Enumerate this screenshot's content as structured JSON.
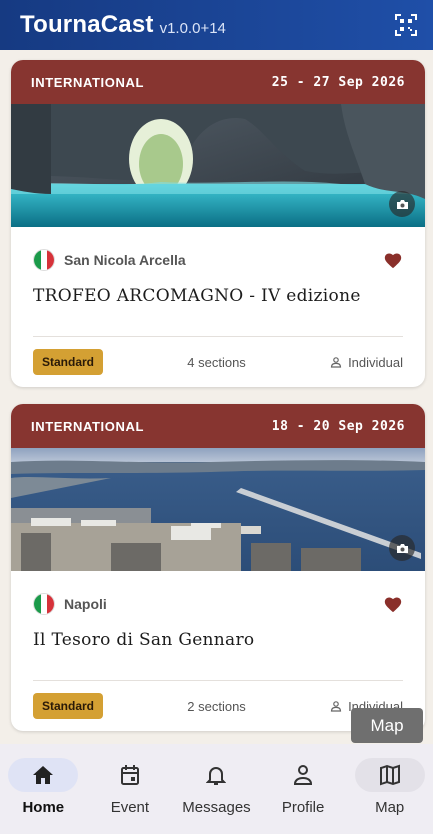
{
  "app": {
    "title": "TournaCast",
    "version": "v1.0.0+14",
    "qr_icon": "qr-scan-icon"
  },
  "events": [
    {
      "type": "INTERNATIONAL",
      "dates": "25 - 27 Sep 2026",
      "location": "San Nicola Arcella",
      "flag": "italy",
      "name": "TROFEO ARCOMAGNO - IV edizione",
      "badge": "Standard",
      "sections": "4 sections",
      "mode": "Individual",
      "favorite": true
    },
    {
      "type": "INTERNATIONAL",
      "dates": "18 - 20 Sep 2026",
      "location": "Napoli",
      "flag": "italy",
      "name": "Il Tesoro di San Gennaro",
      "badge": "Standard",
      "sections": "2 sections",
      "mode": "Individual",
      "favorite": true
    }
  ],
  "fab": {
    "label": "Map"
  },
  "nav": [
    {
      "label": "Home",
      "icon": "home-icon",
      "active": true
    },
    {
      "label": "Event",
      "icon": "calendar-icon",
      "active": false
    },
    {
      "label": "Messages",
      "icon": "bell-icon",
      "active": false
    },
    {
      "label": "Profile",
      "icon": "person-icon",
      "active": false
    },
    {
      "label": "Map",
      "icon": "map-icon",
      "active": false
    }
  ],
  "colors": {
    "appbar": "#1f4fa8",
    "card_header": "#873530",
    "badge": "#d4a033",
    "heart": "#8a2f2a"
  }
}
